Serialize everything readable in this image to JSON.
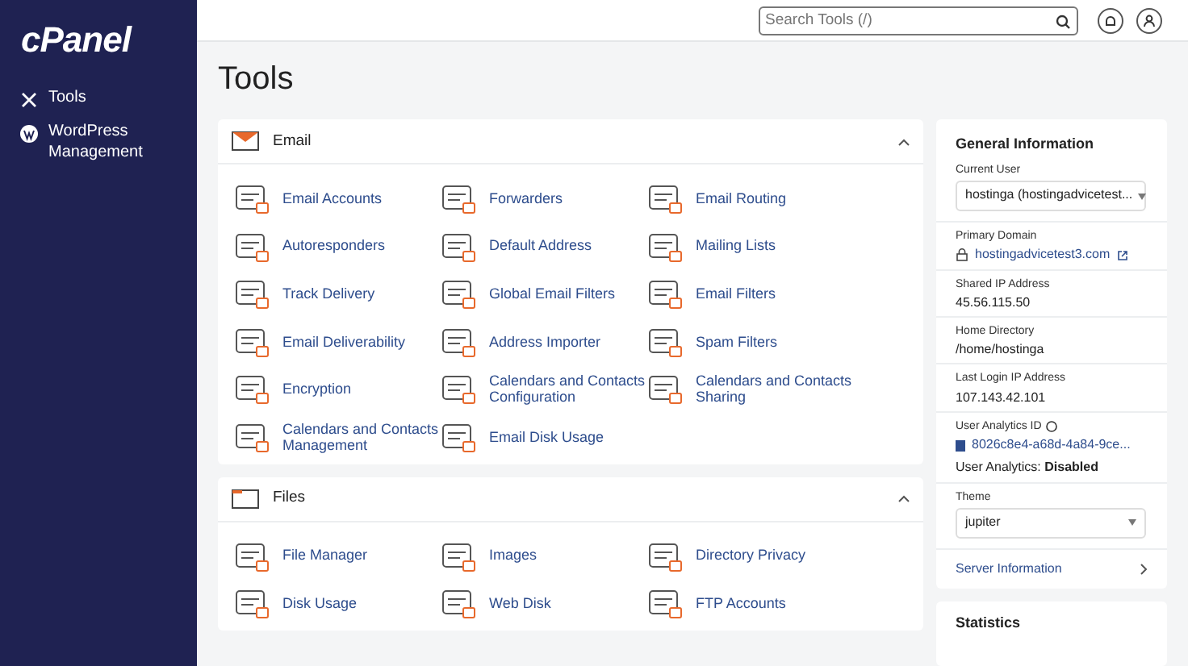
{
  "logo": "cPanel",
  "sidebar": {
    "items": [
      {
        "label": "Tools",
        "kind": "tools"
      },
      {
        "label": "WordPress Management",
        "kind": "wordpress"
      }
    ]
  },
  "search": {
    "placeholder": "Search Tools (/)"
  },
  "page_title": "Tools",
  "sections": [
    {
      "title": "Email",
      "kind": "email",
      "expanded": true,
      "items": [
        "Email Accounts",
        "Forwarders",
        "Email Routing",
        "Autoresponders",
        "Default Address",
        "Mailing Lists",
        "Track Delivery",
        "Global Email Filters",
        "Email Filters",
        "Email Deliverability",
        "Address Importer",
        "Spam Filters",
        "Encryption",
        "Calendars and Contacts Configuration",
        "Calendars and Contacts Sharing",
        "Calendars and Contacts Management",
        "Email Disk Usage"
      ]
    },
    {
      "title": "Files",
      "kind": "files",
      "expanded": true,
      "items": [
        "File Manager",
        "Images",
        "Directory Privacy",
        "Disk Usage",
        "Web Disk",
        "FTP Accounts"
      ]
    }
  ],
  "info_panel": {
    "title": "General Information",
    "fields": [
      {
        "kind": "select",
        "label": "Current User",
        "value": "hostinga (hostingadvicetest..."
      },
      {
        "kind": "link",
        "label": "Primary Domain",
        "value": "hostingadvicetest3.com"
      },
      {
        "kind": "text",
        "label": "Shared IP Address",
        "value": "45.56.115.50"
      },
      {
        "kind": "text",
        "label": "Home Directory",
        "value": "/home/hostinga"
      },
      {
        "kind": "text",
        "label": "Last Login IP Address",
        "value": "107.143.42.101"
      },
      {
        "kind": "analytics",
        "label": "User Analytics ID",
        "value": "8026c8e4-a68d-4a84-9ce...",
        "status": "User Analytics: **Disabled**"
      },
      {
        "kind": "select",
        "label": "Theme",
        "value": "jupiter"
      }
    ],
    "link": "Server Information"
  },
  "statistics": {
    "title": "Statistics"
  }
}
